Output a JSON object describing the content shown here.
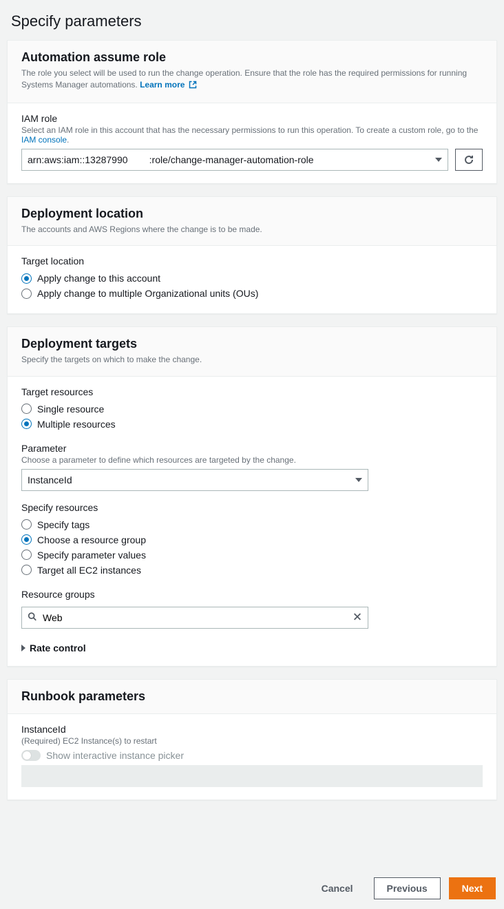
{
  "page_title": "Specify parameters",
  "assume_role": {
    "title": "Automation assume role",
    "desc": "The role you select will be used to run the change operation. Ensure that the role has the required permissions for running Systems Manager automations. ",
    "learn_more": "Learn more",
    "iam_role_label": "IAM role",
    "iam_role_desc_pre": "Select an IAM role in this account that has the necessary permissions to run this operation. To create a custom role, go to the ",
    "iam_console_link": "IAM console",
    "iam_role_value": "arn:aws:iam::13287990        :role/change-manager-automation-role"
  },
  "deploy_location": {
    "title": "Deployment location",
    "desc": "The accounts and AWS Regions where the change is to be made.",
    "target_label": "Target location",
    "options": [
      "Apply change to this account",
      "Apply change to multiple Organizational units (OUs)"
    ]
  },
  "deploy_targets": {
    "title": "Deployment targets",
    "desc": "Specify the targets on which to make the change.",
    "target_resources_label": "Target resources",
    "target_resources_options": [
      "Single resource",
      "Multiple resources"
    ],
    "parameter_label": "Parameter",
    "parameter_desc": "Choose a parameter to define which resources are targeted by the change.",
    "parameter_value": "InstanceId",
    "specify_resources_label": "Specify resources",
    "specify_resources_options": [
      "Specify tags",
      "Choose a resource group",
      "Specify parameter values",
      "Target all EC2 instances"
    ],
    "resource_groups_label": "Resource groups",
    "resource_groups_value": "Web",
    "rate_control": "Rate control"
  },
  "runbook": {
    "title": "Runbook parameters",
    "instance_label": "InstanceId",
    "instance_desc": "(Required) EC2 Instance(s) to restart",
    "toggle_label": "Show interactive instance picker"
  },
  "footer": {
    "cancel": "Cancel",
    "previous": "Previous",
    "next": "Next"
  }
}
